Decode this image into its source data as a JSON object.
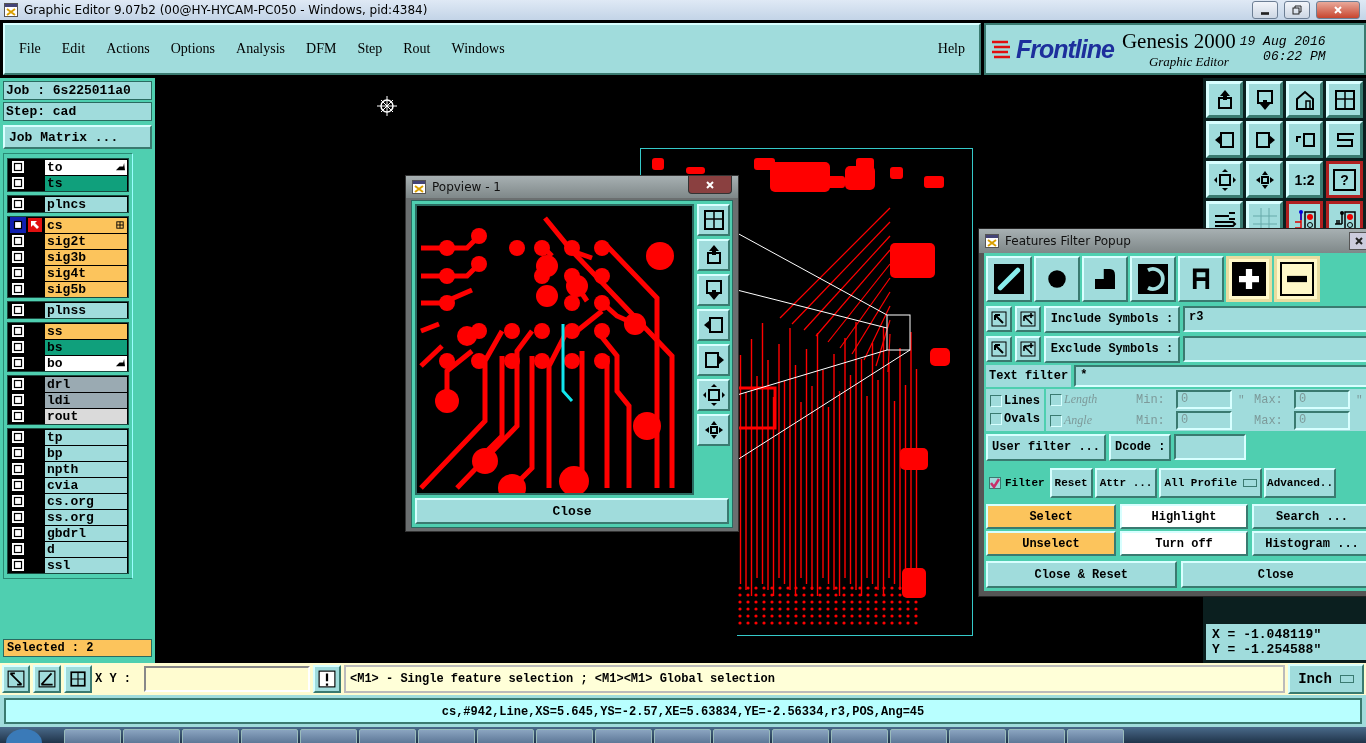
{
  "window": {
    "title": "Graphic Editor 9.07b2 (00@HY-HYCAM-PC050 - Windows, pid:4384)"
  },
  "menu": {
    "items": [
      "File",
      "Edit",
      "Actions",
      "Options",
      "Analysis",
      "DFM",
      "Step",
      "Rout",
      "Windows"
    ],
    "help": "Help"
  },
  "brand": {
    "logo": "Frontline",
    "product": "Genesis 2000",
    "subtitle": "Graphic Editor",
    "date": "19 Aug 2016",
    "time": "06:22 PM"
  },
  "job_panel": {
    "job": "Job : 6s225011a0",
    "step": "Step: cad",
    "matrix_button": "Job Matrix ...",
    "layer_groups": [
      {
        "layers": [
          {
            "name": "to",
            "color": "#ffffff",
            "checked": false,
            "selected": false,
            "kind": "arrow"
          },
          {
            "name": "ts",
            "color": "#10a07c",
            "checked": false,
            "selected": false,
            "kind": "plain"
          }
        ]
      },
      {
        "layers": [
          {
            "name": "plncs",
            "color": "#a0dcdc",
            "checked": false,
            "selected": false,
            "kind": "plain"
          }
        ]
      },
      {
        "layers": [
          {
            "name": "cs",
            "color": "#fcc45c",
            "checked": false,
            "selected": true,
            "kind": "grid"
          },
          {
            "name": "sig2t",
            "color": "#fcc45c",
            "checked": false,
            "selected": false,
            "kind": "plain"
          },
          {
            "name": "sig3b",
            "color": "#fcc45c",
            "checked": false,
            "selected": false,
            "kind": "plain"
          },
          {
            "name": "sig4t",
            "color": "#fcc45c",
            "checked": false,
            "selected": false,
            "kind": "plain"
          },
          {
            "name": "sig5b",
            "color": "#fcc45c",
            "checked": false,
            "selected": false,
            "kind": "plain"
          }
        ]
      },
      {
        "layers": [
          {
            "name": "plnss",
            "color": "#a0dcdc",
            "checked": false,
            "selected": false,
            "kind": "plain"
          }
        ]
      },
      {
        "layers": [
          {
            "name": "ss",
            "color": "#fcc45c",
            "checked": false,
            "selected": false,
            "kind": "plain"
          },
          {
            "name": "bs",
            "color": "#10a07c",
            "checked": false,
            "selected": false,
            "kind": "plain"
          },
          {
            "name": "bo",
            "color": "#ffffff",
            "checked": false,
            "selected": false,
            "kind": "arrow"
          }
        ]
      },
      {
        "layers": [
          {
            "name": "drl",
            "color": "#9aaab2",
            "checked": false,
            "selected": false,
            "kind": "plain"
          },
          {
            "name": "ldi",
            "color": "#9aaab2",
            "checked": false,
            "selected": false,
            "kind": "plain"
          },
          {
            "name": "rout",
            "color": "#dadada",
            "checked": false,
            "selected": false,
            "kind": "plain"
          }
        ]
      },
      {
        "layers": [
          {
            "name": "tp",
            "color": "#a0dcdc",
            "checked": false,
            "selected": false,
            "kind": "plain"
          },
          {
            "name": "bp",
            "color": "#a0dcdc",
            "checked": false,
            "selected": false,
            "kind": "plain"
          },
          {
            "name": "npth",
            "color": "#a0dcdc",
            "checked": false,
            "selected": false,
            "kind": "plain"
          },
          {
            "name": "cvia",
            "color": "#a0dcdc",
            "checked": false,
            "selected": false,
            "kind": "plain"
          },
          {
            "name": "cs.org",
            "color": "#a0dcdc",
            "checked": false,
            "selected": false,
            "kind": "plain"
          },
          {
            "name": "ss.org",
            "color": "#a0dcdc",
            "checked": false,
            "selected": false,
            "kind": "plain"
          },
          {
            "name": "gbdrl",
            "color": "#a0dcdc",
            "checked": false,
            "selected": false,
            "kind": "plain"
          },
          {
            "name": "d",
            "color": "#a0dcdc",
            "checked": false,
            "selected": false,
            "kind": "plain"
          },
          {
            "name": "ssl",
            "color": "#a0dcdc",
            "checked": false,
            "selected": false,
            "kind": "plain"
          }
        ]
      }
    ],
    "selected_count": "Selected : 2"
  },
  "toolbar": [
    {
      "kind": "up",
      "on": false
    },
    {
      "kind": "down",
      "on": false
    },
    {
      "kind": "home",
      "on": false
    },
    {
      "kind": "window",
      "on": false
    },
    {
      "kind": "left",
      "on": false
    },
    {
      "kind": "right",
      "on": false
    },
    {
      "kind": "undo",
      "on": false
    },
    {
      "kind": "snake",
      "on": false
    },
    {
      "kind": "fit",
      "on": false
    },
    {
      "kind": "center",
      "on": false
    },
    {
      "kind": "label",
      "label": "1:2",
      "on": false
    },
    {
      "kind": "label",
      "label": "?",
      "on": true
    },
    {
      "kind": "tools",
      "on": false
    },
    {
      "kind": "grid",
      "on": false
    },
    {
      "kind": "net",
      "on": true
    },
    {
      "kind": "net2",
      "on": true
    }
  ],
  "popview": {
    "title": "Popview - 1",
    "tools": [
      {
        "kind": "window"
      },
      {
        "kind": "up"
      },
      {
        "kind": "down"
      },
      {
        "kind": "left"
      },
      {
        "kind": "right"
      },
      {
        "kind": "fit"
      },
      {
        "kind": "center"
      }
    ],
    "close": "Close"
  },
  "features_filter": {
    "title": "Features Filter Popup",
    "feature_types": [
      {
        "kind": "line"
      },
      {
        "kind": "pad"
      },
      {
        "kind": "surface"
      },
      {
        "kind": "arc"
      },
      {
        "kind": "text"
      }
    ],
    "polarity": [
      {
        "kind": "positive",
        "selected": true
      },
      {
        "kind": "negative",
        "selected": false
      }
    ],
    "include": {
      "label": "Include Symbols :",
      "value": "r3"
    },
    "exclude": {
      "label": "Exclude Symbols :"
    },
    "text_filter": {
      "label": "Text filter",
      "value": "*"
    },
    "shapes": [
      {
        "label": "Lines",
        "checked": false
      },
      {
        "label": "Ovals",
        "checked": false
      }
    ],
    "ranges": [
      {
        "label": "Length",
        "checked": false,
        "disabled": true,
        "min_label": "Min:",
        "min": "0",
        "max_label": "Max:",
        "max": "0",
        "unit": "\""
      },
      {
        "label": "Angle",
        "checked": false,
        "disabled": true,
        "min_label": "Min:",
        "min": "0",
        "max_label": "Max:",
        "max": "0"
      }
    ],
    "user_filter": "User filter ...",
    "dcode": {
      "label": "Dcode :"
    },
    "filter": {
      "label": "Filter",
      "checked": true
    },
    "buttons": [
      "Reset",
      "Attr ..."
    ],
    "profile": "All Profile",
    "advanced": "Advanced..",
    "actions": [
      {
        "label": "Select",
        "kind": "action"
      },
      {
        "label": "Highlight",
        "kind": "mode"
      },
      {
        "label": "Search ...",
        "kind": "tool"
      },
      {
        "label": "Unselect",
        "kind": "action"
      },
      {
        "label": "Turn off",
        "kind": "mode"
      },
      {
        "label": "Histogram ...",
        "kind": "tool"
      }
    ],
    "footer": [
      "Close & Reset",
      "Close"
    ]
  },
  "coordinates": [
    "X = -1.048119\"",
    "Y = -1.254588\""
  ],
  "bottom_bar": {
    "xy_label": "X Y :",
    "message": "<M1> - Single feature selection ; <M1><M1> Global selection",
    "units": "Inch"
  },
  "status_bar": "cs,#942,Line,XS=5.645,YS=-2.57,XE=5.63834,YE=-2.56334,r3,POS,Ang=45"
}
